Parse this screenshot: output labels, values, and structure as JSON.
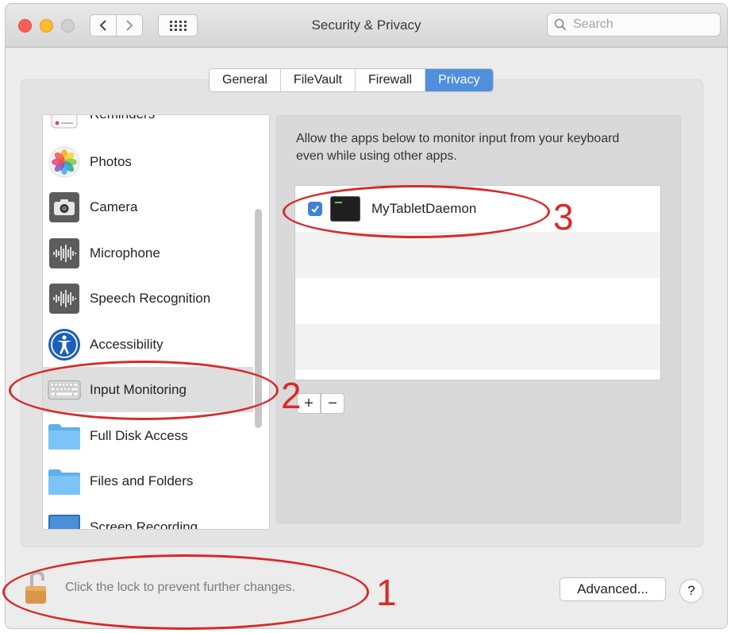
{
  "window": {
    "title": "Security & Privacy",
    "search_placeholder": "Search"
  },
  "tabs": [
    {
      "label": "General",
      "active": false
    },
    {
      "label": "FileVault",
      "active": false
    },
    {
      "label": "Firewall",
      "active": false
    },
    {
      "label": "Privacy",
      "active": true
    }
  ],
  "sidebar": {
    "items": [
      {
        "label": "Reminders",
        "icon": "reminders-icon",
        "partial": true
      },
      {
        "label": "Photos",
        "icon": "photos-icon"
      },
      {
        "label": "Camera",
        "icon": "camera-icon"
      },
      {
        "label": "Microphone",
        "icon": "microphone-icon"
      },
      {
        "label": "Speech Recognition",
        "icon": "speech-recognition-icon"
      },
      {
        "label": "Accessibility",
        "icon": "accessibility-icon"
      },
      {
        "label": "Input Monitoring",
        "icon": "keyboard-icon",
        "selected": true
      },
      {
        "label": "Full Disk Access",
        "icon": "folder-icon"
      },
      {
        "label": "Files and Folders",
        "icon": "folder-icon"
      },
      {
        "label": "Screen Recording",
        "icon": "screen-recording-icon",
        "partial": true
      }
    ]
  },
  "panel": {
    "description": "Allow the apps below to monitor input from your keyboard even while using other apps.",
    "apps": [
      {
        "name": "MyTabletDaemon",
        "checked": true
      }
    ],
    "add_label": "+",
    "remove_label": "−"
  },
  "footer": {
    "lock_text": "Click the lock to prevent further changes.",
    "advanced_label": "Advanced...",
    "help_label": "?"
  },
  "annotations": {
    "one": "1",
    "two": "2",
    "three": "3",
    "color": "#d72a2a"
  },
  "colors": {
    "accent": "#4f8fde",
    "checkbox": "#3f82d8"
  }
}
